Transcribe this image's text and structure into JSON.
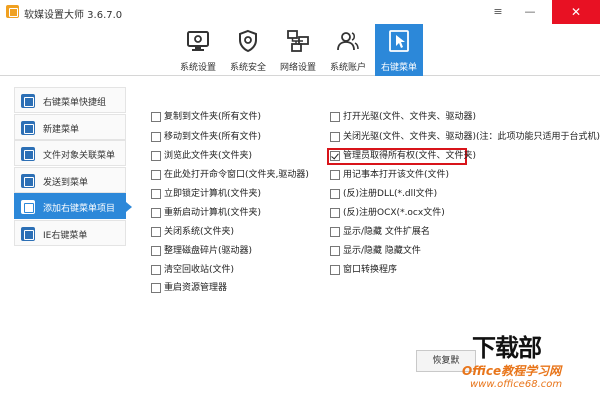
{
  "window": {
    "title": "软媒设置大师 3.6.7.0",
    "menu_glyph": "≡",
    "minimize_glyph": "—",
    "close_glyph": "✕"
  },
  "toolbar": {
    "items": [
      {
        "label": "系统设置",
        "icon": "monitor-gear-icon"
      },
      {
        "label": "系统安全",
        "icon": "shield-gear-icon"
      },
      {
        "label": "网络设置",
        "icon": "network-icon"
      },
      {
        "label": "系统账户",
        "icon": "users-icon"
      },
      {
        "label": "右键菜单",
        "icon": "cursor-click-icon",
        "active": true
      }
    ]
  },
  "sidebar": {
    "items": [
      {
        "label": "右键菜单快捷组"
      },
      {
        "label": "新建菜单"
      },
      {
        "label": "文件对象关联菜单"
      },
      {
        "label": "发送到菜单"
      },
      {
        "label": "添加右键菜单项目",
        "active": true
      },
      {
        "label": "IE右键菜单"
      }
    ]
  },
  "options": {
    "left": [
      {
        "label": "复制到文件夹(所有文件)",
        "checked": false
      },
      {
        "label": "移动到文件夹(所有文件)",
        "checked": false
      },
      {
        "label": "浏览此文件夹(文件夹)",
        "checked": false
      },
      {
        "label": "在此处打开命令窗口(文件夹,驱动器)",
        "checked": false
      },
      {
        "label": "立即锁定计算机(文件夹)",
        "checked": false
      },
      {
        "label": "重新启动计算机(文件夹)",
        "checked": false
      },
      {
        "label": "关闭系统(文件夹)",
        "checked": false
      },
      {
        "label": "整理磁盘碎片(驱动器)",
        "checked": false
      },
      {
        "label": "清空回收站(文件)",
        "checked": false
      },
      {
        "label": "重启资源管理器",
        "checked": false
      }
    ],
    "right": [
      {
        "label": "打开光驱(文件、文件夹、驱动器)",
        "checked": false
      },
      {
        "label": "关闭光驱(文件、文件夹、驱动器)(注：此项功能只适用于台式机)",
        "checked": false
      },
      {
        "label": "管理员取得所有权(文件、文件夹)",
        "checked": true
      },
      {
        "label": "用记事本打开该文件(文件)",
        "checked": false
      },
      {
        "label": "(反)注册DLL(*.dll文件)",
        "checked": false
      },
      {
        "label": "(反)注册OCX(*.ocx文件)",
        "checked": false
      },
      {
        "label": "显示/隐藏 文件扩展名",
        "checked": false
      },
      {
        "label": "显示/隐藏 隐藏文件",
        "checked": false
      },
      {
        "label": "窗口转换程序",
        "checked": false
      }
    ]
  },
  "buttons": {
    "restore": "恢复默"
  },
  "watermark": {
    "logo": "下载部",
    "site": "Office教程学习网",
    "url": "www.office68.com"
  },
  "colors": {
    "accent": "#2c88d9",
    "highlight": "#d8141a",
    "close": "#e81123",
    "watermark": "#e8751a"
  }
}
